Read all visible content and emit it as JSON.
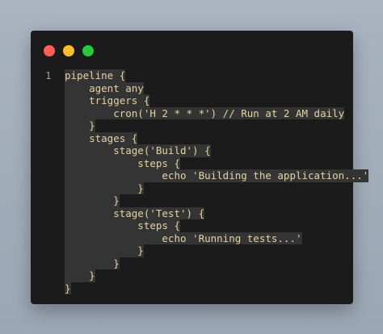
{
  "window": {
    "controls": {
      "close_color": "#ff5f56",
      "minimize_color": "#ffbd2e",
      "maximize_color": "#27c93f"
    }
  },
  "editor": {
    "line_number": "1",
    "lines": [
      "pipeline {",
      "    agent any",
      "    triggers {",
      "        cron('H 2 * * *') // Run at 2 AM daily",
      "    }",
      "    stages {",
      "        stage('Build') {",
      "            steps {",
      "                echo 'Building the application...'",
      "            }",
      "        }",
      "        stage('Test') {",
      "            steps {",
      "                echo 'Running tests...'",
      "            }",
      "        }",
      "    }",
      "}"
    ]
  }
}
